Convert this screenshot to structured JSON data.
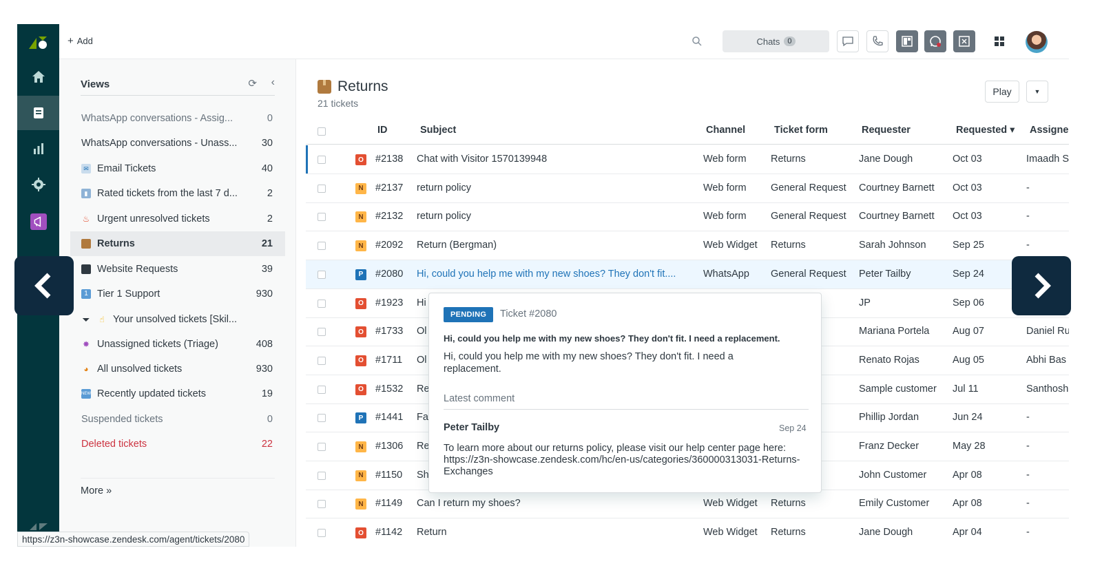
{
  "topbar": {
    "add_label": "Add",
    "chats_label": "Chats",
    "chats_count": "0"
  },
  "views": {
    "title": "Views",
    "items": [
      {
        "label": "WhatsApp conversations - Assig...",
        "count": "0",
        "icon": ""
      },
      {
        "label": "WhatsApp conversations - Unass...",
        "count": "30",
        "icon": ""
      },
      {
        "label": "Email Tickets",
        "count": "40",
        "icon": "envelope-icon"
      },
      {
        "label": "Rated tickets from the last 7 d...",
        "count": "2",
        "icon": "bar-chart-icon"
      },
      {
        "label": "Urgent unresolved tickets",
        "count": "2",
        "icon": "fire-icon"
      },
      {
        "label": "Returns",
        "count": "21",
        "icon": "package-icon"
      },
      {
        "label": "Website Requests",
        "count": "39",
        "icon": "laptop-icon"
      },
      {
        "label": "Tier 1 Support",
        "count": "930",
        "icon": "one-icon"
      },
      {
        "label": "Your unsolved tickets [Skil...",
        "count": "",
        "icon": "filter-hand-icon"
      },
      {
        "label": "Unassigned tickets (Triage)",
        "count": "408",
        "icon": "sparkle-icon"
      },
      {
        "label": "All unsolved tickets",
        "count": "930",
        "icon": "party-icon"
      },
      {
        "label": "Recently updated tickets",
        "count": "19",
        "icon": "new-icon"
      },
      {
        "label": "Suspended tickets",
        "count": "0",
        "icon": ""
      },
      {
        "label": "Deleted tickets",
        "count": "22",
        "icon": ""
      }
    ],
    "more_label": "More »"
  },
  "main": {
    "title": "Returns",
    "subtitle": "21 tickets",
    "play_label": "Play",
    "columns": {
      "id": "ID",
      "subject": "Subject",
      "channel": "Channel",
      "form": "Ticket form",
      "requester": "Requester",
      "requested": "Requested ▾",
      "assignee": "Assigne"
    },
    "rows": [
      {
        "status": "O",
        "id": "#2138",
        "subject": "Chat with Visitor 1570139948",
        "channel": "Web form",
        "form": "Returns",
        "requester": "Jane Dough",
        "requested": "Oct 03",
        "assignee": "Imaadh S"
      },
      {
        "status": "N",
        "id": "#2137",
        "subject": "return policy",
        "channel": "Web form",
        "form": "General Request",
        "requester": "Courtney Barnett",
        "requested": "Oct 03",
        "assignee": "-"
      },
      {
        "status": "N",
        "id": "#2132",
        "subject": "return policy",
        "channel": "Web form",
        "form": "General Request",
        "requester": "Courtney Barnett",
        "requested": "Oct 03",
        "assignee": "-"
      },
      {
        "status": "N",
        "id": "#2092",
        "subject": "Return (Bergman)",
        "channel": "Web Widget",
        "form": "Returns",
        "requester": "Sarah Johnson",
        "requested": "Sep 25",
        "assignee": "-"
      },
      {
        "status": "P",
        "id": "#2080",
        "subject": "Hi, could you help me with my new shoes? They don't fit....",
        "channel": "WhatsApp",
        "form": "General Request",
        "requester": "Peter Tailby",
        "requested": "Sep 24",
        "assignee": ""
      },
      {
        "status": "O",
        "id": "#1923",
        "subject": "Hi",
        "channel": "",
        "form": "quest",
        "requester": "JP",
        "requested": "Sep 06",
        "assignee": ""
      },
      {
        "status": "O",
        "id": "#1733",
        "subject": "Ol",
        "channel": "",
        "form": "atus",
        "requester": "Mariana Portela",
        "requested": "Aug 07",
        "assignee": "Daniel Ru"
      },
      {
        "status": "O",
        "id": "#1711",
        "subject": "Ol",
        "channel": "",
        "form": "",
        "requester": "Renato Rojas",
        "requested": "Aug 05",
        "assignee": "Abhi Bas"
      },
      {
        "status": "O",
        "id": "#1532",
        "subject": "Re",
        "channel": "",
        "form": "",
        "requester": "Sample customer",
        "requested": "Jul 11",
        "assignee": "Santhosh"
      },
      {
        "status": "P",
        "id": "#1441",
        "subject": "Fa",
        "channel": "",
        "form": "quest",
        "requester": "Phillip Jordan",
        "requested": "Jun 24",
        "assignee": "-"
      },
      {
        "status": "N",
        "id": "#1306",
        "subject": "Re",
        "channel": "",
        "form": "",
        "requester": "Franz Decker",
        "requested": "May 28",
        "assignee": "-"
      },
      {
        "status": "N",
        "id": "#1150",
        "subject": "Sh",
        "channel": "",
        "form": "",
        "requester": "John Customer",
        "requested": "Apr 08",
        "assignee": "-"
      },
      {
        "status": "N",
        "id": "#1149",
        "subject": "Can I return my shoes?",
        "channel": "Web Widget",
        "form": "Returns",
        "requester": "Emily Customer",
        "requested": "Apr 08",
        "assignee": "-"
      },
      {
        "status": "O",
        "id": "#1142",
        "subject": "Return",
        "channel": "Web Widget",
        "form": "Returns",
        "requester": "Jane Dough",
        "requested": "Apr 04",
        "assignee": "-"
      }
    ]
  },
  "popover": {
    "status": "PENDING",
    "ticket": "Ticket #2080",
    "subject": "Hi, could you help me with my new shoes? They don't fit. I need a replacement.",
    "description": "Hi, could you help me with my new shoes? They don't fit. I need a replacement.",
    "latest_label": "Latest comment",
    "author": "Peter Tailby",
    "date": "Sep 24",
    "comment": "To learn more about our returns policy, please visit our help center page here: https://z3n-showcase.zendesk.com/hc/en-us/categories/360000313031-Returns-Exchanges"
  },
  "status_url": "https://z3n-showcase.zendesk.com/agent/tickets/2080",
  "colors": {
    "rail": "#03363d",
    "accent": "#1f73b7",
    "open": "#e34f32",
    "new": "#ffb648",
    "pending": "#1f73b7",
    "danger": "#cc3340"
  }
}
